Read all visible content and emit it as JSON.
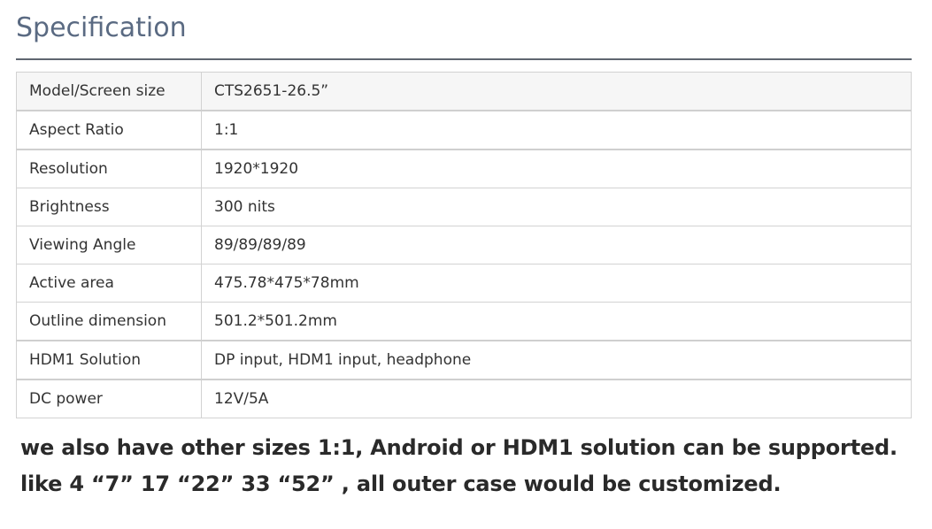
{
  "title": "Specification",
  "specs": [
    {
      "label": "Model/Screen size",
      "value": "CTS2651-26.5”"
    },
    {
      "label": "Aspect Ratio",
      "value": "1:1"
    },
    {
      "label": "Resolution",
      "value": "1920*1920"
    },
    {
      "label": "Brightness",
      "value": "300 nits"
    },
    {
      "label": "Viewing Angle",
      "value": "89/89/89/89"
    },
    {
      "label": "Active area",
      "value": "475.78*475*78mm"
    },
    {
      "label": "Outline dimension",
      "value": "501.2*501.2mm"
    },
    {
      "label": "HDM1 Solution",
      "value": "DP input, HDM1 input, headphone"
    },
    {
      "label": "DC power",
      "value": "12V/5A"
    }
  ],
  "notes": {
    "line1": "we also have other sizes 1:1, Android or HDM1 solution can be supported.",
    "line2": "like 4 “7”  17 “22”  33 “52” , all outer case would be customized."
  }
}
